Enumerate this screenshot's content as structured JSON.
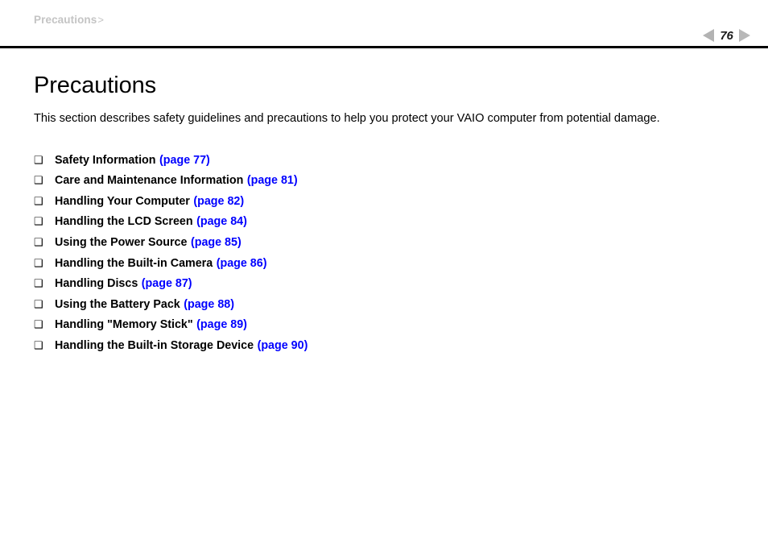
{
  "header": {
    "breadcrumb": "Precautions",
    "breadcrumb_separator": ">",
    "pager": {
      "prev_icon": "triangle-left-icon",
      "next_icon": "triangle-right-icon",
      "page_number": "76"
    }
  },
  "main": {
    "title": "Precautions",
    "intro": "This section describes safety guidelines and precautions to help you protect your VAIO computer from potential damage.",
    "bullet_glyph": "❑",
    "items": [
      {
        "label": "Safety Information",
        "link": "(page 77)"
      },
      {
        "label": "Care and Maintenance Information",
        "link": "(page 81)"
      },
      {
        "label": "Handling Your Computer",
        "link": "(page 82)"
      },
      {
        "label": "Handling the LCD Screen",
        "link": "(page 84)"
      },
      {
        "label": "Using the Power Source",
        "link": "(page 85)"
      },
      {
        "label": "Handling the Built-in Camera",
        "link": "(page 86)"
      },
      {
        "label": "Handling Discs",
        "link": "(page 87)"
      },
      {
        "label": "Using the Battery Pack",
        "link": "(page 88)"
      },
      {
        "label": "Handling \"Memory Stick\"",
        "link": "(page 89)"
      },
      {
        "label": "Handling the Built-in Storage Device",
        "link": "(page 90)"
      }
    ]
  },
  "colors": {
    "link": "#0000FF",
    "breadcrumb": "#C4C4C4",
    "rule": "#000000",
    "arrow": "#B3B3B3"
  }
}
